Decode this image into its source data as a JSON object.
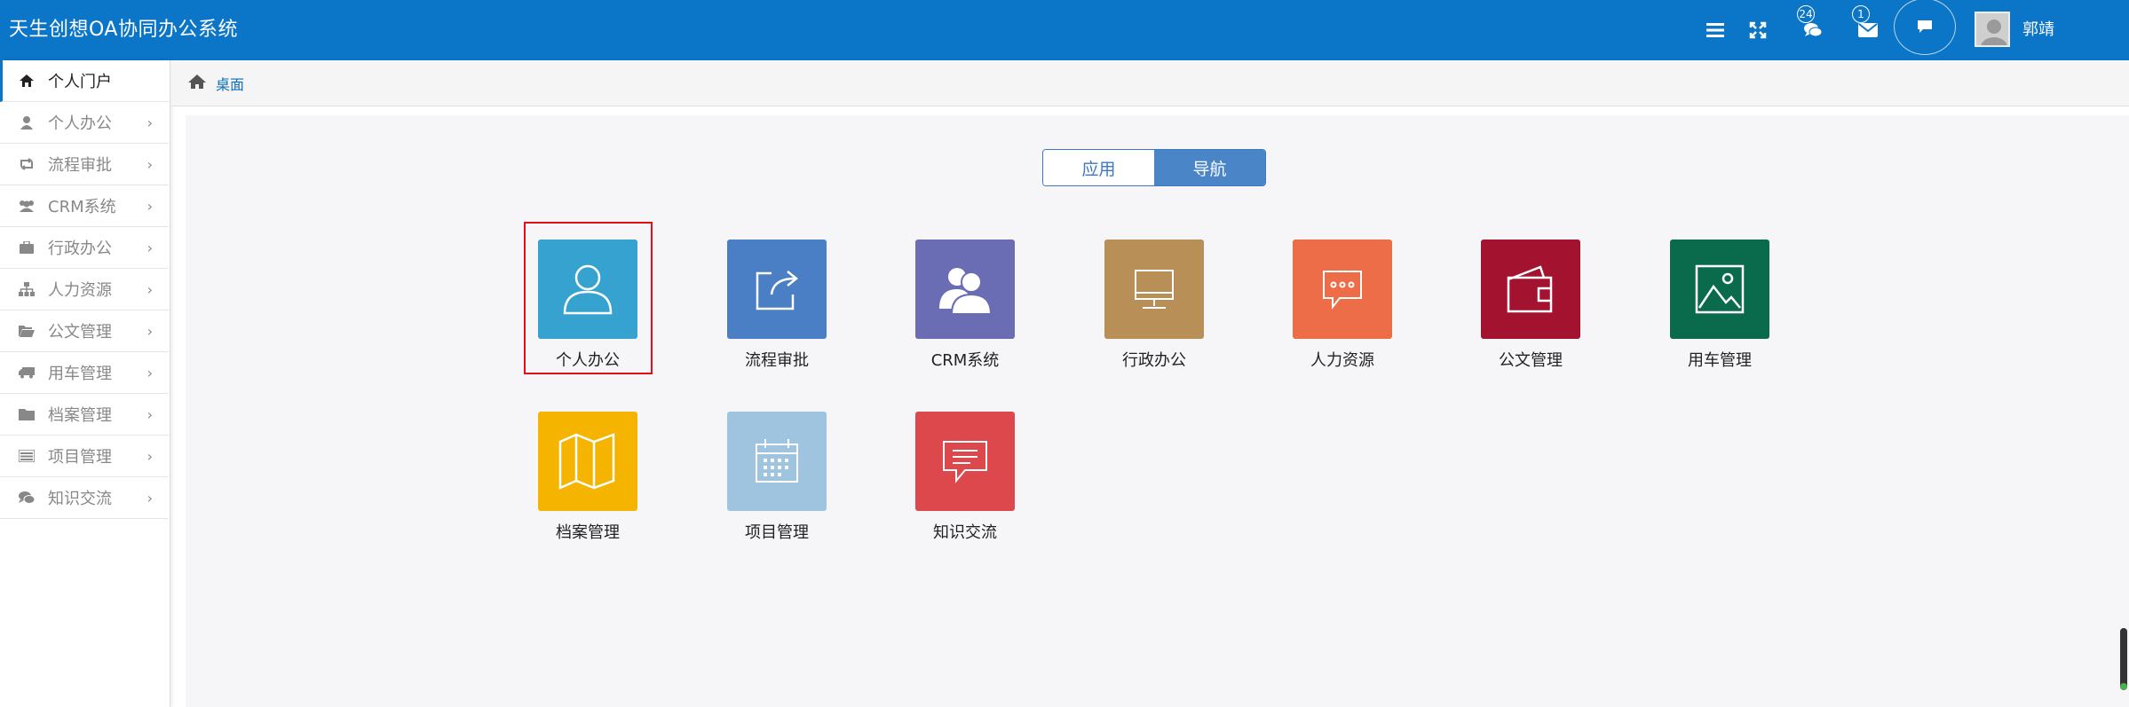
{
  "header": {
    "title": "天生创想OA协同办公系统",
    "chat_badge": "24",
    "mail_badge": "1",
    "username": "郭靖",
    "icons": [
      "menu-icon",
      "fullscreen-icon",
      "comments-icon",
      "envelope-icon",
      "chat-icon"
    ],
    "bg_color": "#0b75c8"
  },
  "sidebar": {
    "items": [
      {
        "label": "个人门户",
        "icon": "home-icon"
      },
      {
        "label": "个人办公",
        "icon": "user-icon"
      },
      {
        "label": "流程审批",
        "icon": "retweet-icon"
      },
      {
        "label": "CRM系统",
        "icon": "users-icon"
      },
      {
        "label": "行政办公",
        "icon": "briefcase-icon"
      },
      {
        "label": "人力资源",
        "icon": "sitemap-icon"
      },
      {
        "label": "公文管理",
        "icon": "folder-open-icon"
      },
      {
        "label": "用车管理",
        "icon": "truck-icon"
      },
      {
        "label": "档案管理",
        "icon": "folder-icon"
      },
      {
        "label": "项目管理",
        "icon": "list-icon"
      },
      {
        "label": "知识交流",
        "icon": "comments-icon"
      }
    ],
    "chevron": "›"
  },
  "breadcrumb": {
    "label": "桌面",
    "icon": "home-icon"
  },
  "tabs": {
    "app": "应用",
    "nav": "导航",
    "selected": "导航"
  },
  "tiles": [
    {
      "label": "个人办公",
      "color": "#36a2cf",
      "icon": "user-outline-icon"
    },
    {
      "label": "流程审批",
      "color": "#4a7fc6",
      "icon": "share-box-icon"
    },
    {
      "label": "CRM系统",
      "color": "#6a6db3",
      "icon": "people-icon"
    },
    {
      "label": "行政办公",
      "color": "#b78f57",
      "icon": "monitor-icon"
    },
    {
      "label": "人力资源",
      "color": "#ec6d47",
      "icon": "message-icon"
    },
    {
      "label": "公文管理",
      "color": "#a3122e",
      "icon": "wallet-icon"
    },
    {
      "label": "用车管理",
      "color": "#096a4c",
      "icon": "picture-icon"
    },
    {
      "label": "档案管理",
      "color": "#f4b400",
      "icon": "map-icon"
    },
    {
      "label": "项目管理",
      "color": "#9fc4df",
      "icon": "calendar-icon"
    },
    {
      "label": "知识交流",
      "color": "#dd484c",
      "icon": "note-icon"
    }
  ]
}
